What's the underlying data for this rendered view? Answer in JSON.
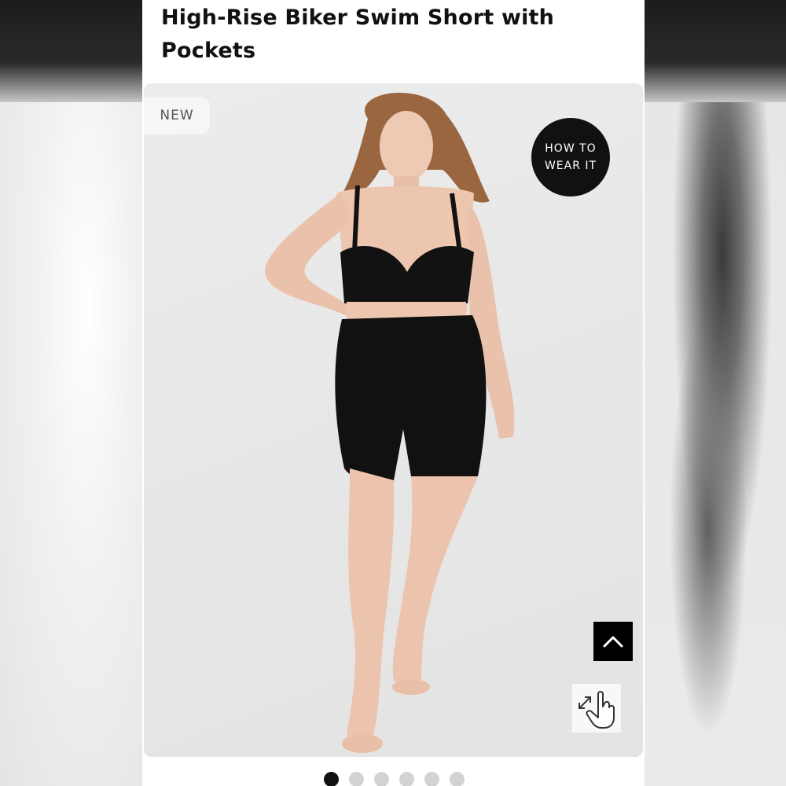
{
  "product": {
    "title": "High-Rise Biker Swim Short with Pockets"
  },
  "gallery": {
    "badge": "NEW",
    "how_to_line1": "HOW TO",
    "how_to_line2": "WEAR IT",
    "dots_count": 6,
    "active_index": 0,
    "back_to_top_icon": "chevron-up-icon",
    "zoom_icon": "pinch-zoom-hand-icon"
  },
  "colors": {
    "accent": "#111111",
    "badge_bg": "#f6f6f6",
    "dot_inactive": "#d3d3d3"
  }
}
